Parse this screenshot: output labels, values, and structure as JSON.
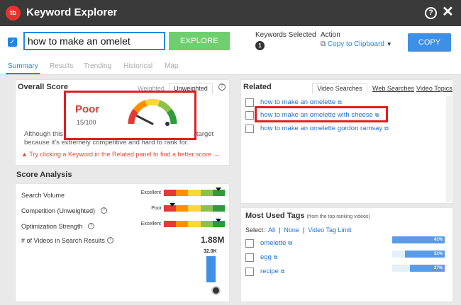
{
  "app": {
    "title": "Keyword Explorer",
    "logo": "tb"
  },
  "toolbar": {
    "search_value": "how to make an omelet",
    "explore_label": "EXPLORE",
    "keywords_selected_label": "Keywords Selected",
    "keywords_selected_count": "1",
    "action_label": "Action",
    "copy_to_clipboard": "Copy to Clipboard",
    "copy_label": "COPY"
  },
  "tabs": [
    "Summary",
    "Results",
    "Trending",
    "Historical",
    "Map"
  ],
  "overall": {
    "title": "Overall Score",
    "tab_weighted": "Weighted",
    "tab_unweighted": "Unweighted",
    "rating": "Poor",
    "score": "15/100",
    "score_fraction": 0.15,
    "description": "Although this keyword is searched very often, it is hard to target because it's extremely competitive and hard to rank for.",
    "tip": "Try clicking a Keyword in the Related panel to find a better score →"
  },
  "score_analysis": {
    "title": "Score Analysis",
    "rows": [
      {
        "label": "Search Volume",
        "rating": "Excellent",
        "level": 1.0
      },
      {
        "label": "Competition (Unweighted)",
        "rating": "Poor",
        "level": 0.1
      },
      {
        "label": "Optimization Strength",
        "rating": "Excellent",
        "level": 1.0
      },
      {
        "label": "# of Videos in Search Results",
        "value": "1.88M"
      }
    ],
    "bar_label": "32.0K"
  },
  "related": {
    "title": "Related",
    "tabs": [
      "Video Searches",
      "Web Searches",
      "Video Topics"
    ],
    "items": [
      "how to make an omelette",
      "how to make an omelette with cheese",
      "how to make an omelette gordon ramsay"
    ]
  },
  "tags": {
    "title": "Most Used Tags",
    "subtitle": "(from the top ranking videos)",
    "select_label": "Select:",
    "select_all": "All",
    "select_none": "None",
    "video_tag_limit": "Video Tag Limit",
    "items": [
      {
        "name": "omelette",
        "percent": "41%",
        "fraction": 0.41
      },
      {
        "name": "egg",
        "percent": "31%",
        "fraction": 0.31
      },
      {
        "name": "recipe",
        "percent": "27%",
        "fraction": 0.27
      }
    ]
  },
  "colors": {
    "accent": "#1e88e5",
    "explore_green": "#6fcf6f",
    "highlight_red": "#e01f1f",
    "scale": [
      "#e53935",
      "#ff8f00",
      "#fdd835",
      "#8bc34a",
      "#2e9c3a"
    ]
  },
  "icons": [
    "help-icon",
    "close-icon",
    "info-icon",
    "external-link-icon",
    "checkbox-icon",
    "clipboard-icon",
    "chevron-down-icon"
  ]
}
